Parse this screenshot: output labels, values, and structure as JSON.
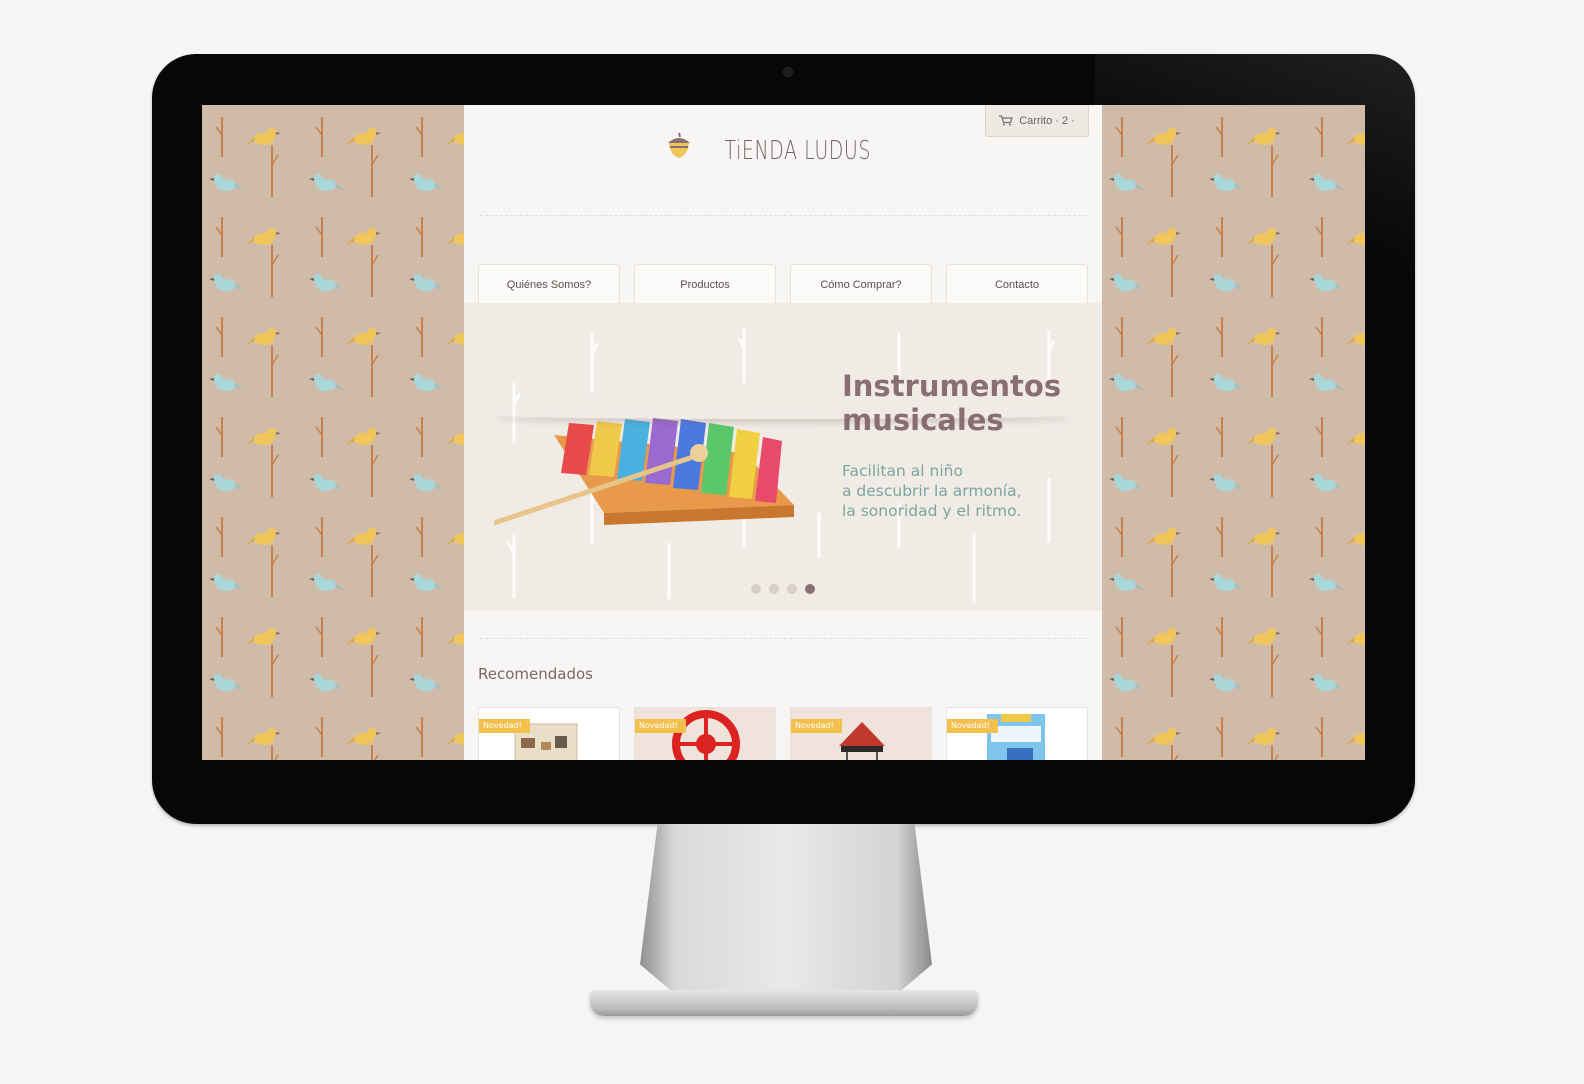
{
  "cart": {
    "label": "Carrito · 2 ·"
  },
  "logo": {
    "text": "TiENDA LUDUS"
  },
  "nav": [
    {
      "label": "Quiénes Somos?"
    },
    {
      "label": "Productos"
    },
    {
      "label": "Cómo Comprar?"
    },
    {
      "label": "Contacto"
    }
  ],
  "banner": {
    "title_line1": "Instrumentos",
    "title_line2": "musicales",
    "text_line1": "Facilitan al niño",
    "text_line2": "a descubrir la armonía,",
    "text_line3": "la sonoridad y el ritmo.",
    "slide_count": 4,
    "active_slide": 4
  },
  "recommended": {
    "title": "Recomendados",
    "items": [
      {
        "badge": "Novedad!",
        "product": "wooden-toy-box"
      },
      {
        "badge": "Novedad!",
        "product": "red-ferris-wheel"
      },
      {
        "badge": "Novedad!",
        "product": "carousel"
      },
      {
        "badge": "Novedad!",
        "product": "domino-game"
      }
    ]
  },
  "colors": {
    "pattern_bg": "#cfbba8",
    "page_bg": "#f8f6f4",
    "title": "#8a6f72",
    "teal_text": "#7aa6a0",
    "badge": "#f3c04e"
  }
}
